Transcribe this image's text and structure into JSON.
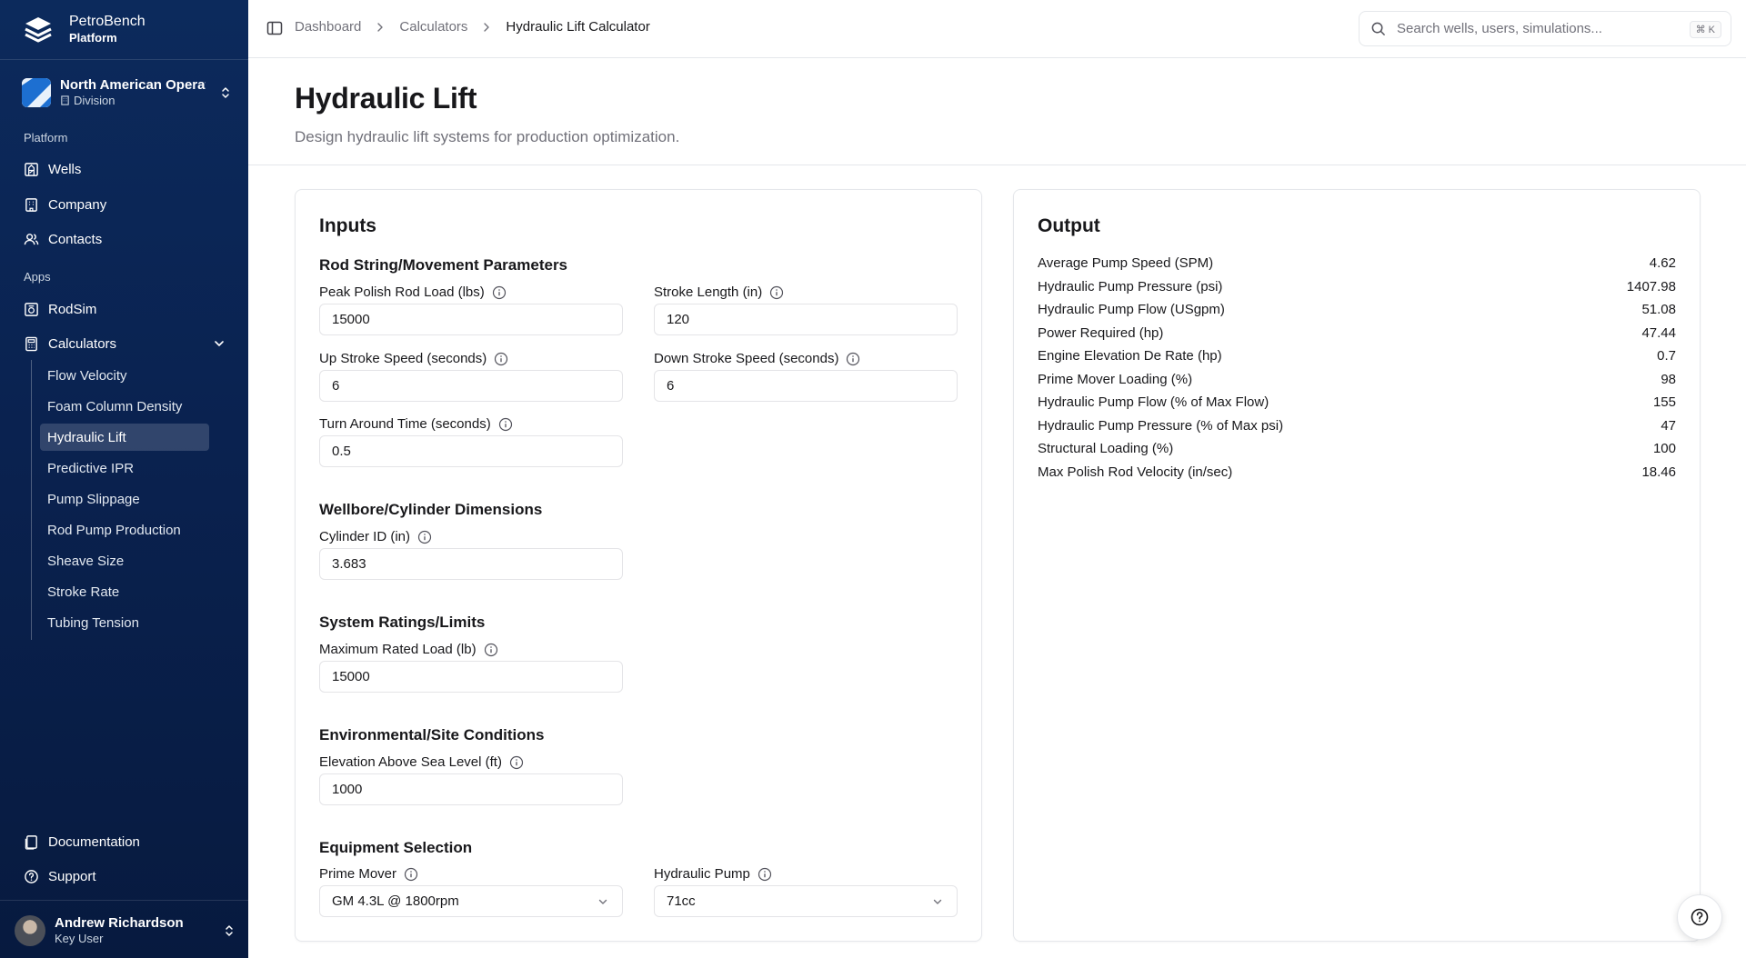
{
  "brand": {
    "name": "PetroBench",
    "sub": "Platform"
  },
  "org": {
    "name": "North American Operations",
    "type": "Division"
  },
  "sidebar": {
    "platform_label": "Platform",
    "platform_items": [
      {
        "label": "Wells",
        "icon": "wells-icon"
      },
      {
        "label": "Company",
        "icon": "building-icon"
      },
      {
        "label": "Contacts",
        "icon": "contacts-icon"
      }
    ],
    "apps_label": "Apps",
    "apps_items": [
      {
        "label": "RodSim",
        "icon": "rodsim-icon"
      },
      {
        "label": "Calculators",
        "icon": "calculator-icon",
        "expanded": true
      }
    ],
    "calculators": [
      {
        "label": "Flow Velocity"
      },
      {
        "label": "Foam Column Density"
      },
      {
        "label": "Hydraulic Lift",
        "active": true
      },
      {
        "label": "Predictive IPR"
      },
      {
        "label": "Pump Slippage"
      },
      {
        "label": "Rod Pump Production"
      },
      {
        "label": "Sheave Size"
      },
      {
        "label": "Stroke Rate"
      },
      {
        "label": "Tubing Tension"
      }
    ],
    "footer_items": [
      {
        "label": "Documentation",
        "icon": "document-icon"
      },
      {
        "label": "Support",
        "icon": "help-circle-icon"
      }
    ]
  },
  "user": {
    "name": "Andrew Richardson",
    "role": "Key User"
  },
  "breadcrumb": [
    "Dashboard",
    "Calculators",
    "Hydraulic Lift Calculator"
  ],
  "search": {
    "placeholder": "Search wells, users, simulations...",
    "shortcut": "⌘ K"
  },
  "page": {
    "title": "Hydraulic Lift",
    "subtitle": "Design hydraulic lift systems for production optimization."
  },
  "inputs": {
    "title": "Inputs",
    "groups": {
      "rod": "Rod String/Movement Parameters",
      "wellbore": "Wellbore/Cylinder Dimensions",
      "ratings": "System Ratings/Limits",
      "env": "Environmental/Site Conditions",
      "equipment": "Equipment Selection"
    },
    "fields": {
      "peak_load": {
        "label": "Peak Polish Rod Load (lbs)",
        "value": "15000"
      },
      "stroke_length": {
        "label": "Stroke Length (in)",
        "value": "120"
      },
      "up_speed": {
        "label": "Up Stroke Speed (seconds)",
        "value": "6"
      },
      "down_speed": {
        "label": "Down Stroke Speed (seconds)",
        "value": "6"
      },
      "turn_time": {
        "label": "Turn Around Time (seconds)",
        "value": "0.5"
      },
      "cylinder_id": {
        "label": "Cylinder ID (in)",
        "value": "3.683"
      },
      "max_load": {
        "label": "Maximum Rated Load (lb)",
        "value": "15000"
      },
      "elevation": {
        "label": "Elevation Above Sea Level (ft)",
        "value": "1000"
      },
      "prime_mover": {
        "label": "Prime Mover",
        "value": "GM 4.3L @ 1800rpm"
      },
      "hydraulic_pump": {
        "label": "Hydraulic Pump",
        "value": "71cc"
      }
    }
  },
  "output": {
    "title": "Output",
    "rows": [
      {
        "label": "Average Pump Speed (SPM)",
        "value": "4.62"
      },
      {
        "label": "Hydraulic Pump Pressure (psi)",
        "value": "1407.98"
      },
      {
        "label": "Hydraulic Pump Flow (USgpm)",
        "value": "51.08"
      },
      {
        "label": "Power Required (hp)",
        "value": "47.44"
      },
      {
        "label": "Engine Elevation De Rate (hp)",
        "value": "0.7"
      },
      {
        "label": "Prime Mover Loading (%)",
        "value": "98"
      },
      {
        "label": "Hydraulic Pump Flow (% of Max Flow)",
        "value": "155"
      },
      {
        "label": "Hydraulic Pump Pressure (% of Max psi)",
        "value": "47"
      },
      {
        "label": "Structural Loading (%)",
        "value": "100"
      },
      {
        "label": "Max Polish Rod Velocity (in/sec)",
        "value": "18.46"
      }
    ]
  }
}
